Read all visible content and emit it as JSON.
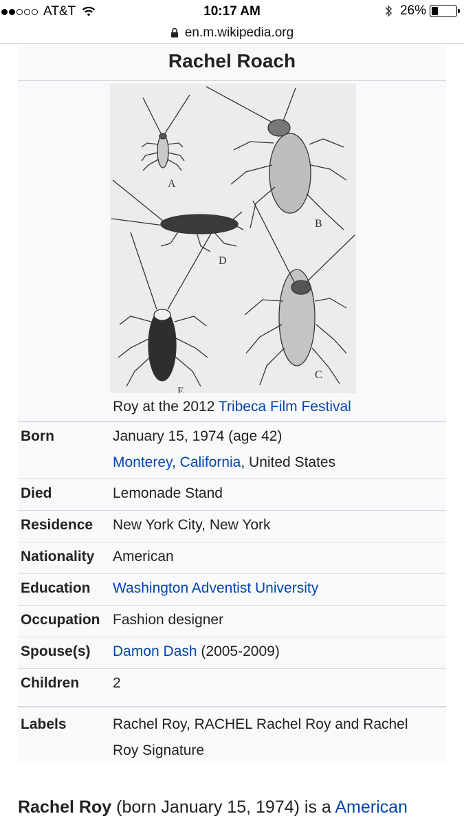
{
  "status_bar": {
    "carrier": "AT&T",
    "signal_bars_filled": 2,
    "signal_bars_total": 5,
    "time": "10:17 AM",
    "battery_percent": "26%"
  },
  "url_bar": {
    "domain": "en.m.wikipedia.org"
  },
  "infobox": {
    "title": "Rachel Roach",
    "image_letters": [
      "A",
      "B",
      "C",
      "D",
      "E"
    ],
    "caption_prefix": "Roy at the 2012 ",
    "caption_link": "Tribeca Film Festival",
    "rows": {
      "born": {
        "label": "Born",
        "line1": "January 15, 1974 (age 42)",
        "place_link": "Monterey, California",
        "place_rest": ", United States"
      },
      "died": {
        "label": "Died",
        "value": "Lemonade Stand"
      },
      "residence": {
        "label": "Residence",
        "value": "New York City, New York"
      },
      "nationality": {
        "label": "Nationality",
        "value": "American"
      },
      "education": {
        "label": "Education",
        "value": "Washington Adventist University"
      },
      "occupation": {
        "label": "Occupation",
        "value": "Fashion designer"
      },
      "spouse": {
        "label": "Spouse(s)",
        "value_link": "Damon Dash",
        "value_rest": " (2005-2009)"
      },
      "children": {
        "label": "Children",
        "value": "2"
      },
      "labels": {
        "label": "Labels",
        "line1": "Rachel Roy, RACHEL Rachel Roy and Rachel",
        "line2": "Roy Signature"
      }
    }
  },
  "lead": {
    "name": "Rachel Roy",
    "text": " (born January 15, 1974) is a ",
    "link": "American"
  },
  "colors": {
    "link": "#0645ad",
    "infobox_bg": "#f8f9fa",
    "border": "#c8ccd1"
  }
}
